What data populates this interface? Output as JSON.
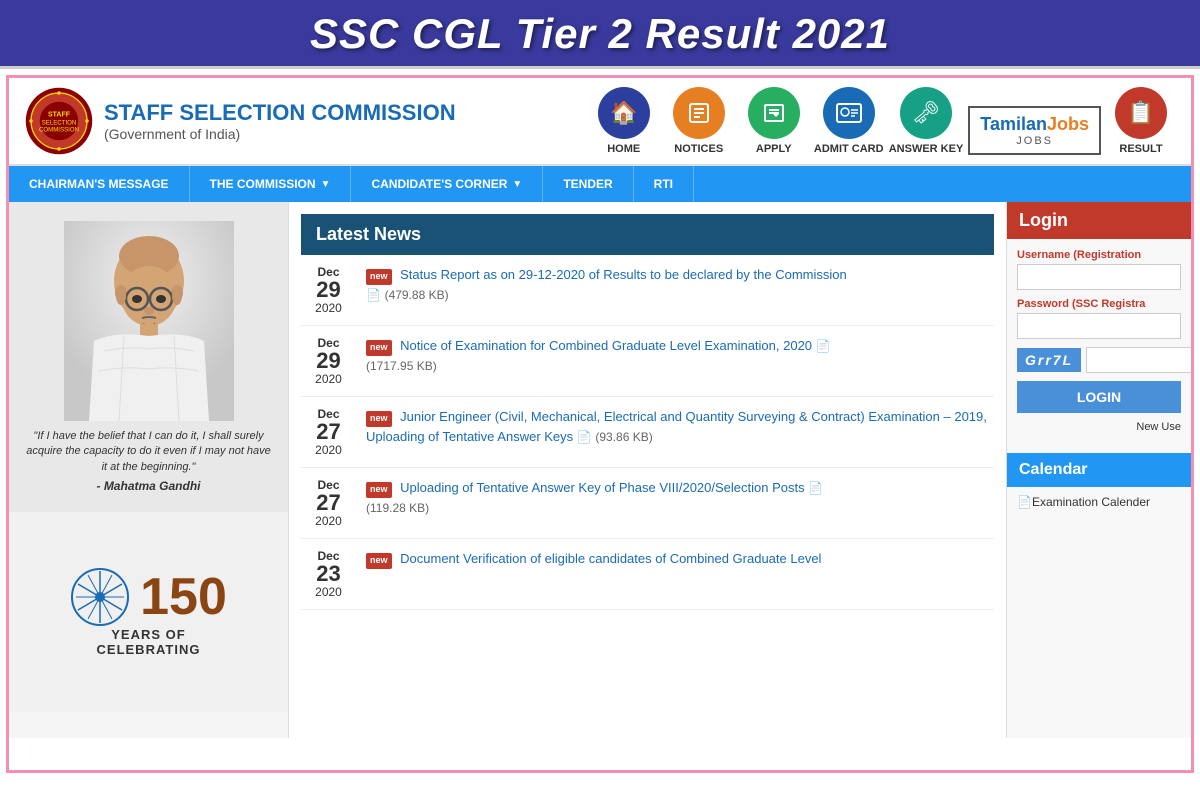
{
  "page_title": "SSC CGL Tier 2 Result 2021",
  "header": {
    "ssc_name": "STAFF SELECTION COMMISSION",
    "ssc_sub": "(Government of India)",
    "tamilan_brand": "Tamilan",
    "tamilan_jobs": "Jobs",
    "tamilan_tagline": "JOBS"
  },
  "nav_icons": [
    {
      "id": "home",
      "label": "HOME",
      "color_class": "home-circle",
      "symbol": "🏠"
    },
    {
      "id": "notices",
      "label": "NOTICES",
      "color_class": "notices-circle",
      "symbol": "⊡"
    },
    {
      "id": "apply",
      "label": "APPLY",
      "color_class": "apply-circle",
      "symbol": "✎"
    },
    {
      "id": "admit_card",
      "label": "ADMIT CARD",
      "color_class": "admit-circle",
      "symbol": "🪪"
    },
    {
      "id": "answer_key",
      "label": "ANSWER KEY",
      "color_class": "answerkey-circle",
      "symbol": "🗝"
    },
    {
      "id": "result",
      "label": "RESULT",
      "color_class": "result-circle",
      "symbol": "📋"
    }
  ],
  "nav_menu": [
    {
      "label": "CHAIRMAN'S MESSAGE",
      "has_dropdown": false
    },
    {
      "label": "THE COMMISSION",
      "has_dropdown": true
    },
    {
      "label": "CANDIDATE'S CORNER",
      "has_dropdown": true
    },
    {
      "label": "TENDER",
      "has_dropdown": false
    },
    {
      "label": "RTI",
      "has_dropdown": false
    }
  ],
  "latest_news_header": "Latest News",
  "news_items": [
    {
      "month": "Dec",
      "day": "29",
      "year": "2020",
      "text": "Status Report as on 29-12-2020 of Results to be declared by the Commission",
      "file_size": "(479.88 KB)",
      "has_new": true,
      "has_pdf": true
    },
    {
      "month": "Dec",
      "day": "29",
      "year": "2020",
      "text": "Notice of Examination for Combined Graduate Level Examination, 2020",
      "file_size": "(1717.95 KB)",
      "has_new": true,
      "has_pdf": true
    },
    {
      "month": "Dec",
      "day": "27",
      "year": "2020",
      "text": "Junior Engineer (Civil, Mechanical, Electrical and Quantity Surveying & Contract) Examination – 2019, Uploading of Tentative Answer Keys",
      "file_size": "(93.86 KB)",
      "has_new": true,
      "has_pdf": true
    },
    {
      "month": "Dec",
      "day": "27",
      "year": "2020",
      "text": "Uploading of Tentative Answer Key of Phase VIII/2020/Selection Posts",
      "file_size": "(119.28 KB)",
      "has_new": true,
      "has_pdf": true
    },
    {
      "month": "Dec",
      "day": "23",
      "year": "2020",
      "text": "Document Verification of eligible candidates of Combined Graduate Level",
      "file_size": "",
      "has_new": true,
      "has_pdf": false
    }
  ],
  "login": {
    "header": "Login",
    "username_label": "Username (Registration",
    "password_label": "Password (SSC Registra",
    "captcha_text": "Grr7L",
    "login_button": "LOGIN",
    "new_user_text": "New Use"
  },
  "calendar": {
    "header": "Calendar",
    "link_text": "Examination Calender"
  },
  "gandhi": {
    "quote": "\"If I have the belief that I can do it, I shall surely acquire the capacity to do it even if I may not have it at the beginning.\"",
    "attribution": "- Mahatma Gandhi"
  },
  "anniversary": {
    "number": "150",
    "years_text": "YEARS OF",
    "celebrating_text": "CELEBRATING"
  }
}
